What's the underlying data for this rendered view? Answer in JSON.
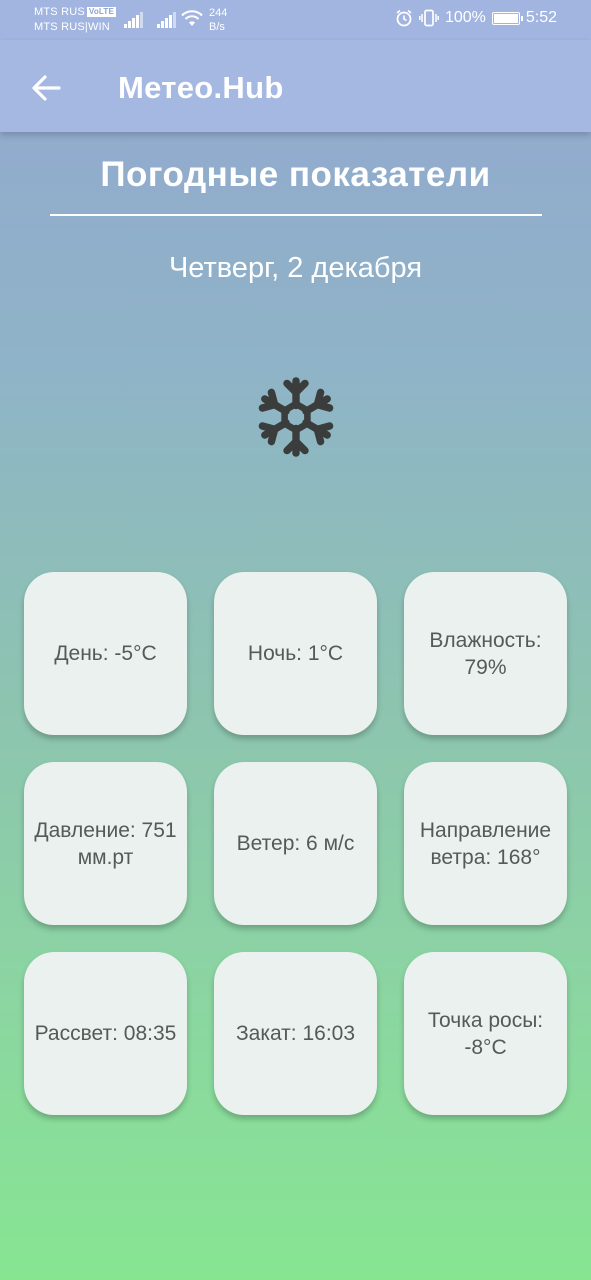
{
  "status_bar": {
    "carrier_1": "MTS RUS",
    "volte": "VoLTE",
    "carrier_2": "MTS RUS|WIN",
    "net_speed_value": "244",
    "net_speed_unit": "B/s",
    "battery": "100%",
    "time": "5:52",
    "icons": [
      "signal-icon",
      "signal-icon",
      "wifi-icon",
      "alarm-icon",
      "vibrate-icon",
      "battery-icon"
    ]
  },
  "app_bar": {
    "title": "Метео.Hub",
    "back_icon": "arrow-left-icon"
  },
  "page": {
    "title": "Погодные показатели",
    "date": "Четверг, 2 декабря",
    "weather_icon": "snowflake-icon"
  },
  "tiles": [
    {
      "label": "День: -5°C"
    },
    {
      "label": "Ночь: 1°C"
    },
    {
      "label": "Влажность: 79%"
    },
    {
      "label": "Давление: 751 мм.рт"
    },
    {
      "label": "Ветер: 6 м/с"
    },
    {
      "label": "Направление ветра: 168°"
    },
    {
      "label": "Рассвет: 08:35"
    },
    {
      "label": "Закат: 16:03"
    },
    {
      "label": "Точка росы: -8°C"
    }
  ],
  "colors": {
    "app_bar": "#a4b8e2",
    "gradient_top": "#93a7cf",
    "gradient_bottom": "#87e592",
    "tile_bg": "#eaf1ee",
    "tile_text": "#555a58",
    "icon": "#3a3d3c"
  }
}
